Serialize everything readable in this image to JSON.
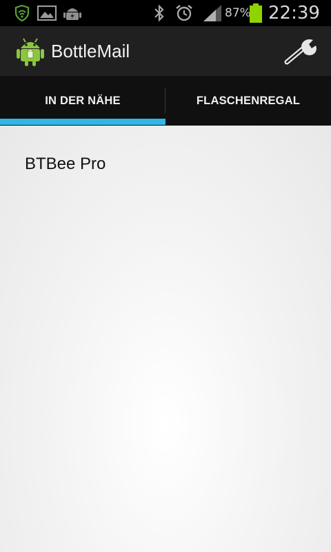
{
  "status_bar": {
    "icons": [
      "shield-icon",
      "image-icon",
      "android-debug-icon",
      "bluetooth-icon",
      "alarm-icon",
      "signal-icon",
      "battery-icon"
    ],
    "battery_percent": "87%",
    "time": "22:39",
    "colors": {
      "shield": "#5aa43a",
      "battery": "#8fd400"
    }
  },
  "action_bar": {
    "title": "BottleMail",
    "settings_icon": "wrench-icon",
    "app_icon": "android-icon"
  },
  "tabs": [
    {
      "label": "IN DER NÄHE",
      "selected": true
    },
    {
      "label": "FLASCHENREGAL",
      "selected": false
    }
  ],
  "accent_color": "#33b5e5",
  "list": {
    "items": [
      {
        "label": "BTBee Pro"
      }
    ]
  }
}
